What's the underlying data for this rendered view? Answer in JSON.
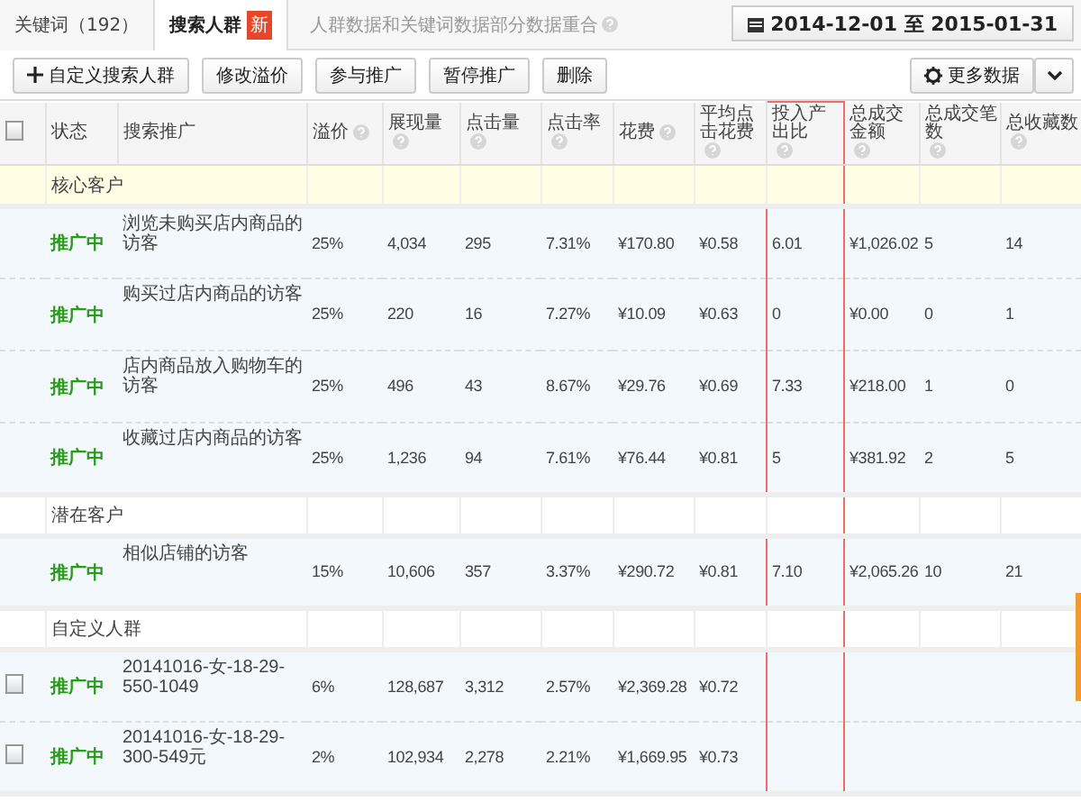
{
  "tabs": [
    {
      "label": "关键词（192）",
      "selected": false
    },
    {
      "label": "搜索人群",
      "selected": true,
      "badge": "新"
    }
  ],
  "notice": "人群数据和关键词数据部分数据重合",
  "date_range": "2014-12-01 至 2015-01-31",
  "toolbar": {
    "buttons": [
      {
        "label": "自定义搜索人群",
        "kind": "add"
      },
      {
        "label": "修改溢价",
        "kind": "plain"
      },
      {
        "label": "参与推广",
        "kind": "plain"
      },
      {
        "label": "暂停推广",
        "kind": "plain"
      },
      {
        "label": "删除",
        "kind": "plain"
      }
    ],
    "more_button": "更多数据"
  },
  "table": {
    "select_all": {
      "checked": false
    },
    "columns": [
      {
        "label": "状态",
        "help": false,
        "highlighted": false
      },
      {
        "label": "搜索推广",
        "help": false,
        "highlighted": false
      },
      {
        "label": "溢价",
        "help": true,
        "highlighted": false
      },
      {
        "label": "展现量",
        "help": true,
        "highlighted": false
      },
      {
        "label": "点击量",
        "help": true,
        "highlighted": false
      },
      {
        "label": "点击率",
        "help": true,
        "highlighted": false
      },
      {
        "label": "花费",
        "help": true,
        "highlighted": false
      },
      {
        "label": "平均点击花费",
        "help": true,
        "highlighted": false
      },
      {
        "label": "投入产出比",
        "help": true,
        "highlighted": true
      },
      {
        "label": "总成交金额",
        "help": true,
        "highlighted": false
      },
      {
        "label": "总成交笔数",
        "help": true,
        "highlighted": false
      },
      {
        "label": "总收藏数",
        "help": true,
        "highlighted": false
      }
    ],
    "sections": [
      {
        "label": "核心客户",
        "highlighted": true,
        "rows": [
          {
            "selectable": false,
            "status": "推广中",
            "name": "浏览未购买店内商品的访客",
            "cells": [
              "25%",
              "4,034",
              "295",
              "7.31%",
              "¥170.80",
              "¥0.58",
              "6.01",
              "¥1,026.02",
              "5",
              "14"
            ]
          },
          {
            "selectable": false,
            "status": "推广中",
            "name": "购买过店内商品的访客",
            "cells": [
              "25%",
              "220",
              "16",
              "7.27%",
              "¥10.09",
              "¥0.63",
              "0",
              "¥0.00",
              "0",
              "1"
            ]
          },
          {
            "selectable": false,
            "status": "推广中",
            "name": "店内商品放入购物车的访客",
            "cells": [
              "25%",
              "496",
              "43",
              "8.67%",
              "¥29.76",
              "¥0.69",
              "7.33",
              "¥218.00",
              "1",
              "0"
            ]
          },
          {
            "selectable": false,
            "status": "推广中",
            "name": "收藏过店内商品的访客",
            "cells": [
              "25%",
              "1,236",
              "94",
              "7.61%",
              "¥76.44",
              "¥0.81",
              "5",
              "¥381.92",
              "2",
              "5"
            ]
          }
        ]
      },
      {
        "label": "潜在客户",
        "highlighted": false,
        "rows": [
          {
            "selectable": false,
            "status": "推广中",
            "name": "相似店铺的访客",
            "cells": [
              "15%",
              "10,606",
              "357",
              "3.37%",
              "¥290.72",
              "¥0.81",
              "7.10",
              "¥2,065.26",
              "10",
              "21"
            ]
          }
        ]
      },
      {
        "label": "自定义人群",
        "highlighted": false,
        "rows": [
          {
            "selectable": true,
            "checked": false,
            "status": "推广中",
            "name": "20141016-女-18-29-550-1049",
            "cells": [
              "6%",
              "128,687",
              "3,312",
              "2.57%",
              "¥2,369.28",
              "¥0.72",
              null,
              null,
              null,
              null
            ]
          },
          {
            "selectable": true,
            "checked": false,
            "status": "推广中",
            "name": "20141016-女-18-29-300-549元",
            "cells": [
              "2%",
              "102,934",
              "2,278",
              "2.21%",
              "¥1,669.95",
              "¥0.73",
              null,
              null,
              null,
              null
            ]
          }
        ]
      }
    ]
  }
}
